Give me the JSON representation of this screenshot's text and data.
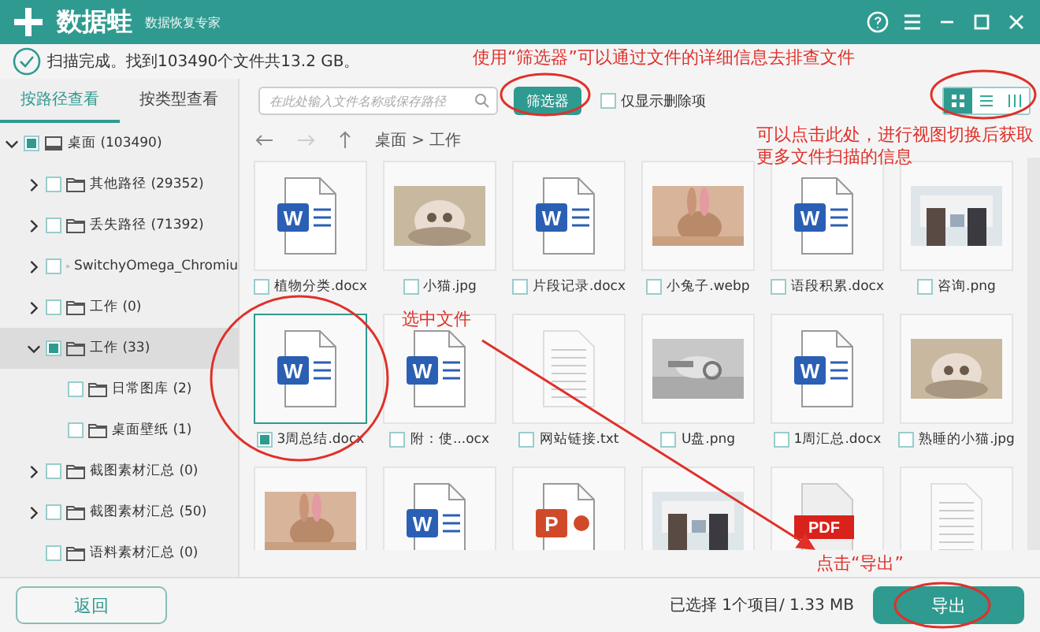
{
  "app": {
    "name": "数据蛙",
    "subtitle": "数据恢复专家"
  },
  "status": "扫描完成。找到103490个文件共13.2 GB。",
  "tabs": [
    {
      "label": "按路径查看",
      "selected": true
    },
    {
      "label": "按类型查看",
      "selected": false
    }
  ],
  "search": {
    "placeholder": "在此处输入文件名称或保存路径"
  },
  "filter_button": "筛选器",
  "deleted_only": {
    "label": "仅显示删除项",
    "checked": false
  },
  "view_modes": [
    {
      "kind": "grid",
      "selected": true
    },
    {
      "kind": "list",
      "selected": false
    },
    {
      "kind": "columns",
      "selected": false
    }
  ],
  "breadcrumb": "桌面 > 工作",
  "tree": [
    {
      "kind": "drive",
      "label": "桌面 (103490)",
      "expanded": true,
      "partial": true,
      "selected": false,
      "children": [
        {
          "kind": "branch",
          "label": "其他路径 (29352)",
          "expanded": false,
          "partial": false,
          "selected": false
        },
        {
          "kind": "branch",
          "label": "丢失路径 (71392)",
          "expanded": false,
          "partial": false,
          "selected": false
        },
        {
          "kind": "branch",
          "label": "SwitchyOmega_Chromiu",
          "expanded": false,
          "partial": false,
          "selected": false
        },
        {
          "kind": "branch",
          "label": "工作 (0)",
          "expanded": false,
          "partial": false,
          "selected": false
        },
        {
          "kind": "branch",
          "label": "工作 (33)",
          "expanded": true,
          "partial": true,
          "selected": true,
          "children": [
            {
              "kind": "leaf",
              "label": "日常图库 (2)",
              "partial": false,
              "selected": false
            },
            {
              "kind": "leaf",
              "label": "桌面壁纸 (1)",
              "partial": false,
              "selected": false
            }
          ]
        },
        {
          "kind": "branch",
          "label": "截图素材汇总 (0)",
          "expanded": false,
          "partial": false,
          "selected": false
        },
        {
          "kind": "branch",
          "label": "截图素材汇总 (50)",
          "expanded": false,
          "partial": false,
          "selected": false
        },
        {
          "kind": "leaf",
          "label": "语料素材汇总 (0)",
          "partial": false,
          "selected": false
        }
      ]
    }
  ],
  "files": [
    {
      "name": "植物分类.docx",
      "kind": "word",
      "icon_text": "W",
      "checked": false,
      "selected": false
    },
    {
      "name": "小猫.jpg",
      "kind": "picture",
      "checked": false,
      "selected": false
    },
    {
      "name": "片段记录.docx",
      "kind": "word",
      "icon_text": "W",
      "checked": false,
      "selected": false
    },
    {
      "name": "小兔子.webp",
      "kind": "picture",
      "checked": false,
      "selected": false
    },
    {
      "name": "语段积累.docx",
      "kind": "word",
      "icon_text": "W",
      "checked": false,
      "selected": false
    },
    {
      "name": "咨询.png",
      "kind": "picture",
      "checked": false,
      "selected": false
    },
    {
      "name": "3周总结.docx",
      "kind": "word",
      "icon_text": "W",
      "checked": true,
      "selected": true
    },
    {
      "name": "附：使...ocx",
      "kind": "word",
      "icon_text": "W",
      "checked": false,
      "selected": false
    },
    {
      "name": "网站链接.txt",
      "kind": "text",
      "checked": false,
      "selected": false
    },
    {
      "name": "U盘.png",
      "kind": "picture",
      "checked": false,
      "selected": false
    },
    {
      "name": "1周汇总.docx",
      "kind": "word",
      "icon_text": "W",
      "checked": false,
      "selected": false
    },
    {
      "name": "熟睡的小猫.jpg",
      "kind": "picture",
      "checked": false,
      "selected": false
    },
    {
      "kind": "picture",
      "selected": false
    },
    {
      "kind": "word",
      "icon_text": "W",
      "selected": false
    },
    {
      "kind": "ppt",
      "icon_text": "P",
      "selected": false
    },
    {
      "kind": "picture",
      "selected": false
    },
    {
      "kind": "pdf",
      "icon_text": "PDF",
      "selected": false
    },
    {
      "kind": "text",
      "selected": false
    }
  ],
  "footer": {
    "back": "返回",
    "selection": "已选择 1个项目/ 1.33 MB",
    "export": "导出"
  },
  "annotations": [
    {
      "kind": "note",
      "text": "使用“筛选器”可以通过文件的详细信息去排查文件"
    },
    {
      "kind": "note",
      "text": "可以点击此处，进行视图切换后获取更多文件扫描的信息"
    },
    {
      "kind": "note",
      "text": "选中文件"
    },
    {
      "kind": "note",
      "text": "点击“导出”"
    }
  ]
}
